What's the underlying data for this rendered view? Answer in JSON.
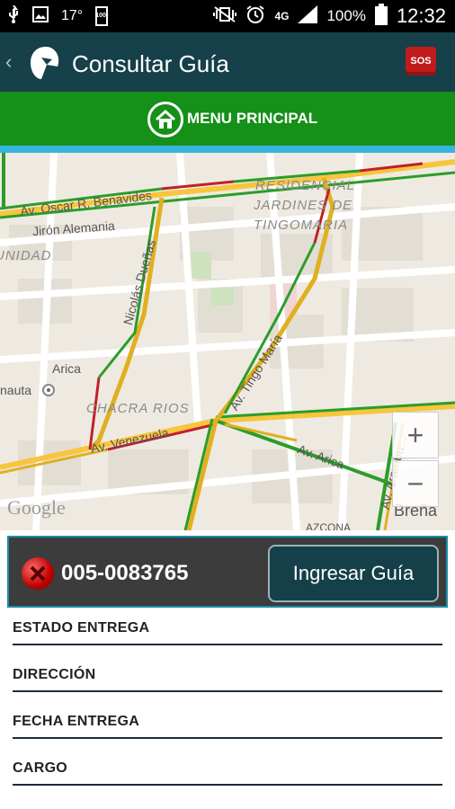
{
  "status_bar": {
    "temperature": "17°",
    "battery_small": "100",
    "network": "4G",
    "battery_percent": "100%",
    "time": "12:32"
  },
  "app_bar": {
    "back_icon": "chevron-left-icon",
    "logo_icon": "app-logo-icon",
    "title": "Consultar Guía",
    "sos_label": "SOS"
  },
  "menu": {
    "label": "MENU PRINCIPAL",
    "icon": "home-icon"
  },
  "map": {
    "labels": {
      "benavides": "Av. Oscar R. Benavides",
      "alemania": "Jirón Alemania",
      "residencial": "RESIDENCIAL",
      "jardines": "JARDINES DE",
      "tingomaria_district": "TINGOMARIA",
      "unidad": "UNIDAD",
      "nicolas": "Nicolás Dueñas",
      "arica_small": "Arica",
      "nauta": "nauta",
      "chacra_rios": "CHACRA RIOS",
      "tingo_maria": "Av. Tingo María",
      "venezuela": "Av. Venezuela",
      "arica": "Av. Arica",
      "aramburu": "Av. Arambu...",
      "brena": "Breña",
      "azcona": "AZCONA"
    },
    "attribution": "Google",
    "zoom_in": "+",
    "zoom_out": "−",
    "traffic_colors": {
      "free": "#2a9d2a",
      "moderate": "#e0b020",
      "heavy": "#c0202a"
    }
  },
  "guia": {
    "status_icon": "error-x-icon",
    "number": "005-0083765",
    "button_label": "Ingresar Guía"
  },
  "fields": [
    {
      "label": "ESTADO ENTREGA"
    },
    {
      "label": "DIRECCIÓN"
    },
    {
      "label": "FECHA ENTREGA"
    },
    {
      "label": "CARGO"
    }
  ]
}
